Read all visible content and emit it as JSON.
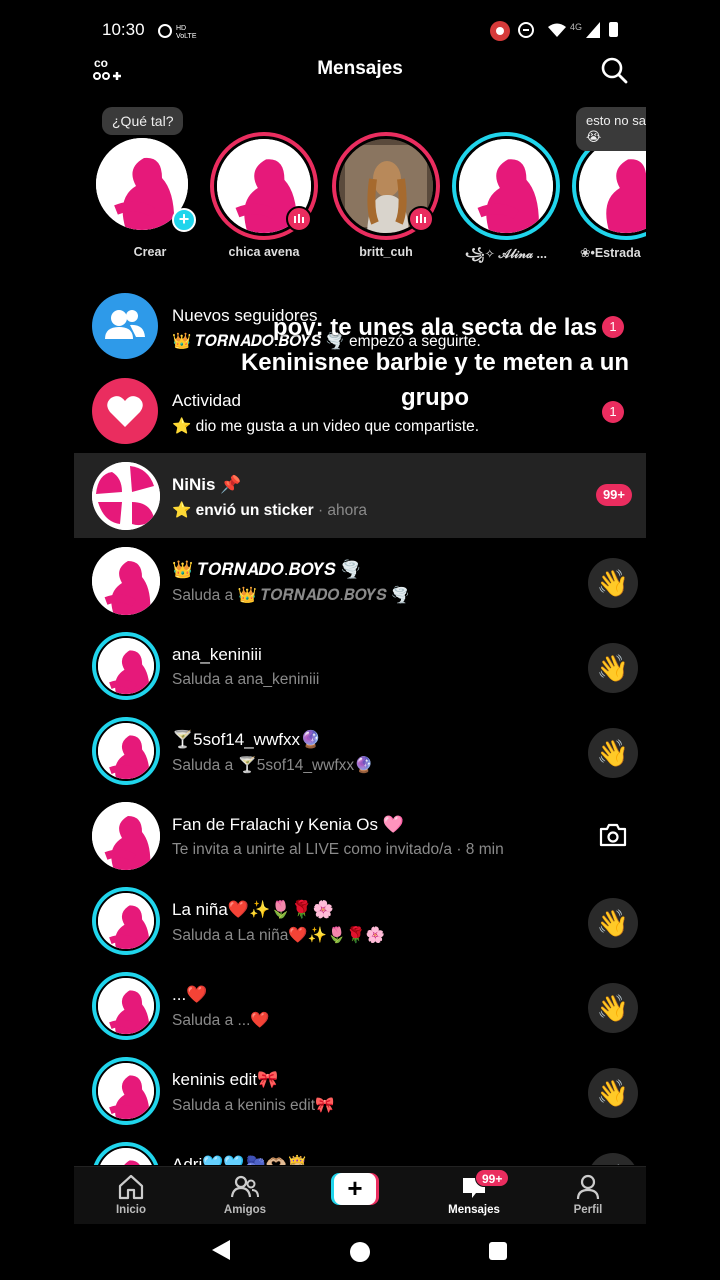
{
  "status_bar": {
    "time": "10:30",
    "data_label": "4G",
    "tiny_label": "HD VoLTE"
  },
  "header": {
    "title": "Mensajes"
  },
  "stories": [
    {
      "name": "Crear",
      "bubble": "¿Qué tal?",
      "ring": "none",
      "badge": "plus"
    },
    {
      "name": "chica avena",
      "ring": "#ea2d5f",
      "badge": "live"
    },
    {
      "name": "britt_cuh",
      "ring": "#ea2d5f",
      "badge": "live"
    },
    {
      "name": "꧁✧ 𝒜𝓁𝒾𝓃𝒶 ...",
      "ring": "#20d5ec"
    },
    {
      "name": "❀•Estrada",
      "bubble": "esto no sa bien😭",
      "ring": "#20d5ec"
    }
  ],
  "system_rows": [
    {
      "title": "Nuevos seguidores",
      "subtitle": "👑 𝑻𝑶𝑹𝑵𝑨𝑫𝑶.𝑩𝑶𝒀𝑺 🌪️ empezó a seguirte.",
      "count": "1",
      "icon": "followers-icon",
      "color": "#2e9ae9"
    },
    {
      "title": "Actividad",
      "subtitle": "⭐ dio me gusta a un video que compartiste.",
      "count": "1",
      "icon": "heart-icon",
      "color": "#ea2d5f"
    }
  ],
  "overlay_caption": "pov: te unes ala secta de las Keninisnee barbie y te meten a un grupo",
  "chats": [
    {
      "name": "NiNis 📌",
      "message": "⭐ envió un sticker",
      "time": "· ahora",
      "badge": "99+",
      "selected": true,
      "ring": "none"
    },
    {
      "name": "👑 𝑻𝑶𝑹𝑵𝑨𝑫𝑶.𝑩𝑶𝒀𝑺 🌪️",
      "message": "Saluda a 👑 𝑻𝑶𝑹𝑵𝑨𝑫𝑶.𝑩𝑶𝒀𝑺 🌪️",
      "action": "wave",
      "ring": "none"
    },
    {
      "name": "ana_keniniii",
      "message": "Saluda a ana_keniniii",
      "action": "wave",
      "ring": "#20d5ec"
    },
    {
      "name": "🍸5sof14_wwfxx🔮",
      "message": "Saluda a 🍸5sof14_wwfxx🔮",
      "action": "wave",
      "ring": "#20d5ec"
    },
    {
      "name": "Fan de Fralachi y Kenia Os 🩷",
      "message": "Te invita a unirte al LIVE como invitado/a · 8 min",
      "action": "camera",
      "ring": "none"
    },
    {
      "name": "La niña❤️✨🌷🌹🌸",
      "message": "Saluda a La niña❤️✨🌷🌹🌸",
      "action": "wave",
      "ring": "#20d5ec"
    },
    {
      "name": "...❤️",
      "message": "Saluda a ...❤️",
      "action": "wave",
      "ring": "#20d5ec"
    },
    {
      "name": "keninis  edit🎀",
      "message": "Saluda a keninis  edit🎀",
      "action": "wave",
      "ring": "#20d5ec"
    },
    {
      "name": "Adri🩵🩵🫐🫶🏼👸🏼",
      "message": "",
      "action": "wave",
      "ring": "#20d5ec"
    }
  ],
  "tabs": [
    {
      "label": "Inicio",
      "icon": "home-icon"
    },
    {
      "label": "Amigos",
      "icon": "friends-icon"
    },
    {
      "label": "",
      "icon": "create-plus-icon"
    },
    {
      "label": "Mensajes",
      "icon": "inbox-icon",
      "badge": "99+",
      "active": true
    },
    {
      "label": "Perfil",
      "icon": "profile-icon"
    }
  ],
  "colors": {
    "accent_pink": "#ea2d5f",
    "accent_cyan": "#20d5ec",
    "background": "#000000"
  }
}
